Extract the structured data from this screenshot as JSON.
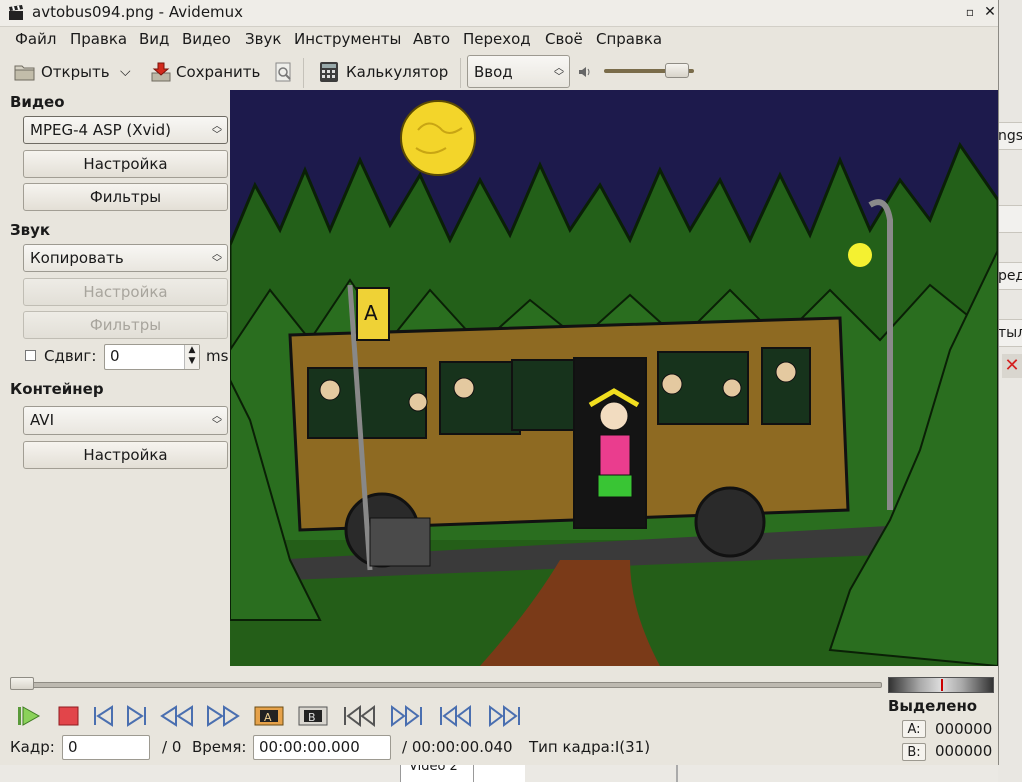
{
  "window": {
    "title": "avtobus094.png - Avidemux"
  },
  "menu": [
    "Файл",
    "Правка",
    "Вид",
    "Видео",
    "Звук",
    "Инструменты",
    "Авто",
    "Переход",
    "Своё",
    "Справка"
  ],
  "toolbar": {
    "open_label": "Открыть",
    "save_label": "Сохранить",
    "calc_label": "Калькулятор",
    "input_select": "Ввод",
    "volume_percent": 90
  },
  "video": {
    "header": "Видео",
    "codec": "MPEG-4 ASP (Xvid)",
    "config_label": "Настройка",
    "filters_label": "Фильтры"
  },
  "audio": {
    "header": "Звук",
    "codec": "Копировать",
    "config_label": "Настройка",
    "filters_label": "Фильтры",
    "shift_label": "Сдвиг:",
    "shift_value": "0",
    "shift_unit": "ms"
  },
  "container": {
    "header": "Контейнер",
    "format": "AVI",
    "config_label": "Настройка"
  },
  "status": {
    "frame_label": "Кадр:",
    "frame_value": "0",
    "frame_total": "/ 0",
    "time_label": "Время:",
    "time_value": "00:00:00.000",
    "time_total": "/ 00:00:00.040",
    "frame_type": "Тип кадра:I(31)"
  },
  "selection": {
    "header": "Выделено",
    "a_label": "A:",
    "a_value": "000000",
    "b_label": "B:",
    "b_value": "000000"
  },
  "background": {
    "frag1": "ngs",
    "frag2": "ред",
    "frag3": "тыл",
    "tab": "Video 2"
  }
}
